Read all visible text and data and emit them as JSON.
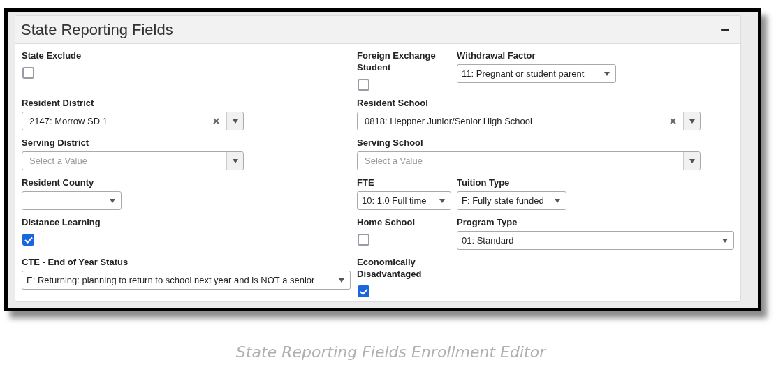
{
  "panel": {
    "title": "State Reporting Fields",
    "collapse_icon": "−"
  },
  "rows": [
    [
      {
        "kind": "checkbox",
        "label": "State Exclude",
        "checked": false
      },
      {
        "kind": "checkbox",
        "label": "Foreign Exchange Student",
        "checked": false
      },
      {
        "kind": "select",
        "label": "Withdrawal Factor",
        "value": "11: Pregnant or student parent"
      }
    ],
    [
      {
        "kind": "combo",
        "label": "Resident District",
        "value": "2147: Morrow SD 1"
      },
      {
        "kind": "combo",
        "label": "Resident School",
        "value": "0818: Heppner Junior/Senior High School"
      }
    ],
    [
      {
        "kind": "combo",
        "label": "Serving District",
        "placeholder": "Select a Value"
      },
      {
        "kind": "combo",
        "label": "Serving School",
        "placeholder": "Select a Value"
      }
    ],
    [
      {
        "kind": "select",
        "label": "Resident County"
      },
      {
        "kind": "select",
        "label": "FTE",
        "value": "10: 1.0 Full time"
      },
      {
        "kind": "select",
        "label": "Tuition Type",
        "value": "F: Fully state funded"
      }
    ],
    [
      {
        "kind": "checkbox",
        "label": "Distance Learning",
        "checked": true
      },
      {
        "kind": "checkbox",
        "label": "Home School",
        "checked": false
      },
      {
        "kind": "select",
        "label": "Program Type",
        "value": "01: Standard"
      }
    ],
    [
      {
        "kind": "select",
        "label": "CTE - End of Year Status",
        "value": "E: Returning: planning to return to school next year and is NOT a senior"
      },
      {
        "kind": "checkbox",
        "label": "Economically Disadvantaged",
        "checked": true
      }
    ]
  ],
  "caption": "State Reporting Fields Enrollment Editor"
}
